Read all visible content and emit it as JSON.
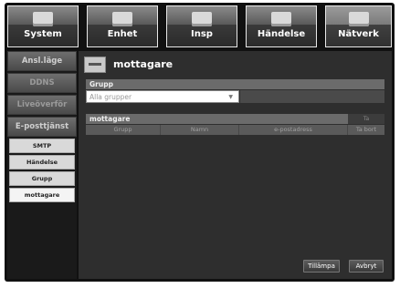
{
  "nav": {
    "tabs": [
      {
        "label": "System",
        "icon": "system-monitor-icon"
      },
      {
        "label": "Enhet",
        "icon": "camera-dome-icon"
      },
      {
        "label": "Insp",
        "icon": "record-icon"
      },
      {
        "label": "Händelse",
        "icon": "event-icon"
      },
      {
        "label": "Nätverk",
        "icon": "network-icon"
      }
    ]
  },
  "sidebar": {
    "items": [
      {
        "label": "Ansl.läge"
      },
      {
        "label": "DDNS"
      },
      {
        "label": "Liveöverför"
      },
      {
        "label": "E-posttjänst"
      }
    ],
    "subitems": [
      {
        "label": "SMTP"
      },
      {
        "label": "Händelse"
      },
      {
        "label": "Grupp"
      },
      {
        "label": "mottagare"
      }
    ]
  },
  "main": {
    "title": "mottagare",
    "group": {
      "header": "Grupp",
      "select_value": "Alla grupper"
    },
    "recipients": {
      "header": "mottagare",
      "delete_label": "Ta",
      "columns": [
        "Grupp",
        "Namn",
        "e-postadress",
        "Ta bort"
      ]
    },
    "buttons": {
      "apply": "Tillämpa",
      "cancel": "Avbryt"
    }
  }
}
